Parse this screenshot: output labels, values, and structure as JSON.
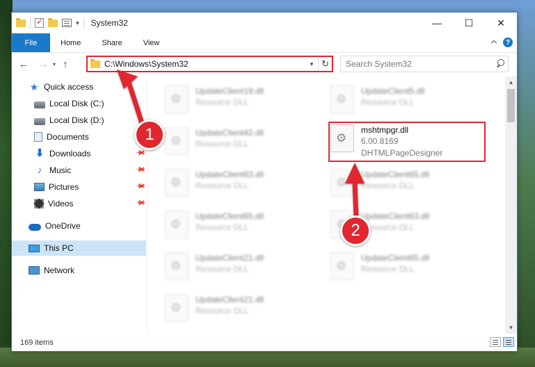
{
  "window": {
    "title": "System32",
    "controls": {
      "minimize": "—",
      "maximize": "☐",
      "close": "✕"
    }
  },
  "ribbon": {
    "tabs": [
      "File",
      "Home",
      "Share",
      "View"
    ]
  },
  "nav": {
    "address": "C:\\Windows\\System32",
    "search_placeholder": "Search System32"
  },
  "sidebar": {
    "items": [
      {
        "label": "Quick access",
        "icon": "star-icon"
      },
      {
        "label": "Local Disk (C:)",
        "icon": "disk-icon"
      },
      {
        "label": "Local Disk (D:)",
        "icon": "disk-icon"
      },
      {
        "label": "Documents",
        "icon": "documents-icon"
      },
      {
        "label": "Downloads",
        "icon": "downloads-icon"
      },
      {
        "label": "Music",
        "icon": "music-icon"
      },
      {
        "label": "Pictures",
        "icon": "pictures-icon"
      },
      {
        "label": "Videos",
        "icon": "videos-icon"
      },
      {
        "label": "OneDrive",
        "icon": "onedrive-icon"
      },
      {
        "label": "This PC",
        "icon": "this-pc-icon"
      },
      {
        "label": "Network",
        "icon": "network-icon"
      }
    ]
  },
  "files": {
    "left": [
      {
        "name": "UpdateClient19.dll",
        "type": "Resource DLL"
      },
      {
        "name": "UpdateClient42.dll",
        "type": "Resource DLL"
      },
      {
        "name": "UpdateClient63.dll",
        "type": "Resource DLL"
      },
      {
        "name": "UpdateClient65.dll",
        "type": "Resource DLL"
      },
      {
        "name": "UpdateClient21.dll",
        "type": "Resource DLL"
      },
      {
        "name": "UpdateClient21.dll",
        "type": "Resource DLL"
      }
    ],
    "right": [
      {
        "name": "UpdateClient5.dll",
        "type": "Resource DLL"
      },
      {
        "name": "mshtmpgr.dll",
        "version": "6.00.8169",
        "type": "DHTMLPageDesigner",
        "highlighted": true
      },
      {
        "name": "UpdateClient65.dll",
        "type": "Resource DLL"
      },
      {
        "name": "UpdateClient63.dll",
        "type": "Resource DLL"
      },
      {
        "name": "UpdateClient65.dll",
        "type": "Resource DLL"
      },
      {
        "name": "",
        "type": ""
      }
    ]
  },
  "status": {
    "item_count": "169 items"
  },
  "annotations": {
    "step1": "1",
    "step2": "2",
    "color": "#e0262f"
  }
}
